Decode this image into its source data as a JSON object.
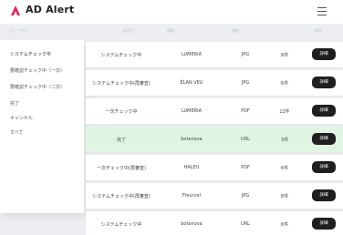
{
  "app": {
    "title": "AD Alert"
  },
  "column_headers": [
    "ステータス",
    "広告主",
    "媒体",
    "期間",
    "操作"
  ],
  "sidebar": {
    "items": [
      {
        "label": "システムチェック中",
        "active": true
      },
      {
        "label": "要確認チェック中（一次）"
      },
      {
        "label": "要確認チェック中（二次）"
      },
      {
        "label": "完了"
      },
      {
        "label": "キャンセル"
      },
      {
        "label": "すべて"
      }
    ]
  },
  "rows": [
    {
      "status": "システムチェック中",
      "brand": "LUMERIA",
      "format": "JPG",
      "period": "8件",
      "action": "詳細",
      "done": false
    },
    {
      "status": "システムチェック中(再審査)",
      "brand": "ÉLAN VEU",
      "format": "JPG",
      "period": "6件",
      "action": "詳細",
      "done": false
    },
    {
      "status": "一次チェック中",
      "brand": "LUMERIA",
      "format": "PDF",
      "period": "12件",
      "action": "詳細",
      "done": false
    },
    {
      "status": "完了",
      "brand": "botanova",
      "format": "URL",
      "period": "3件",
      "action": "詳細",
      "done": true
    },
    {
      "status": "一次チェック中(再審査)",
      "brand": "HALEU",
      "format": "PDF",
      "period": "6件",
      "action": "詳細",
      "done": false
    },
    {
      "status": "システムチェック中(再審査)",
      "brand": "Fleurvel",
      "format": "JPG",
      "period": "8件",
      "action": "詳細",
      "done": false
    },
    {
      "status": "システムチェック中",
      "brand": "botanova",
      "format": "URL",
      "period": "6件",
      "action": "詳細",
      "done": false
    }
  ],
  "colors": {
    "accent": "#1f1f1f",
    "done_row": "#dff5e2",
    "logo": "#e0245e"
  }
}
